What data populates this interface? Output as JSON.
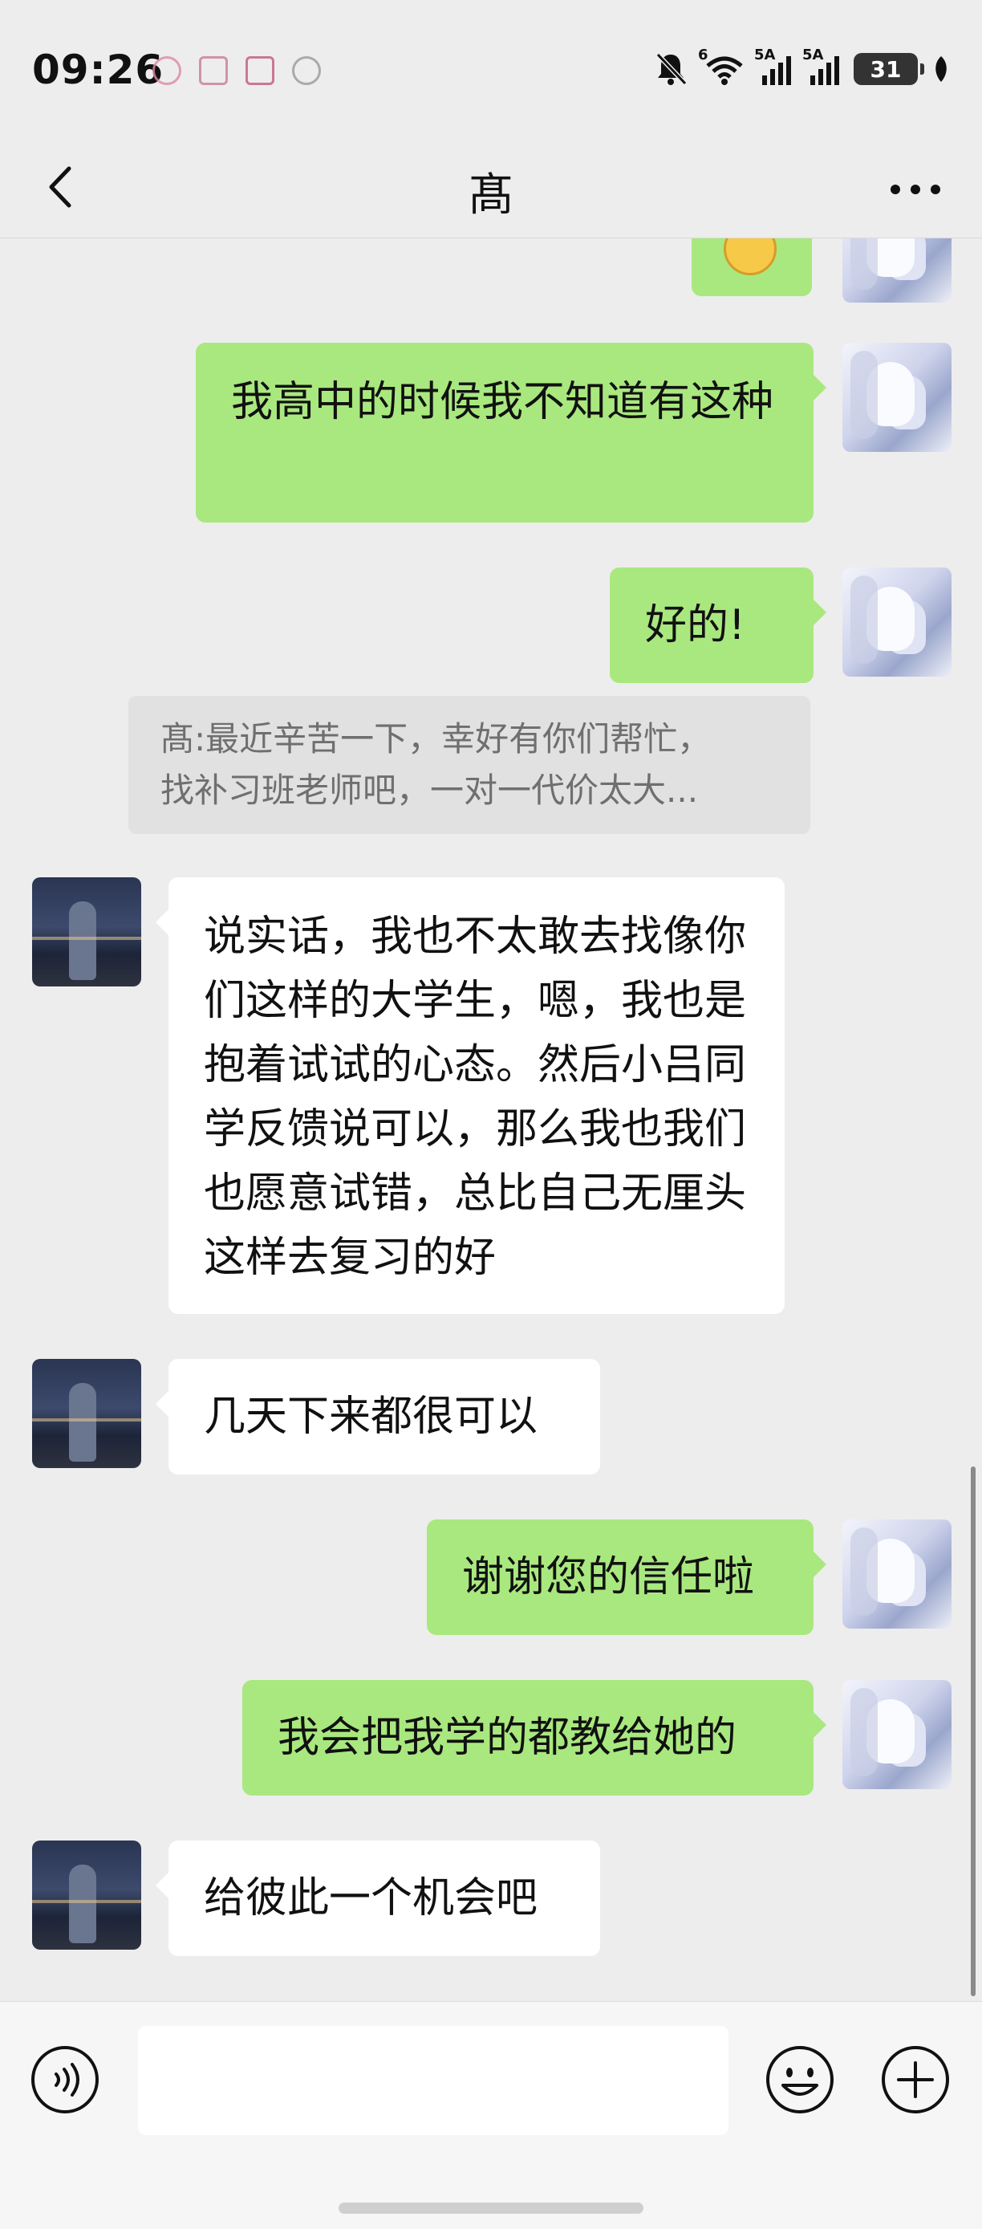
{
  "status_bar": {
    "time": "09:26",
    "signal_1_label": "5A",
    "signal_2_label": "5A",
    "wifi_label": "6",
    "battery": "31"
  },
  "header": {
    "title": "髙",
    "back_icon": "chevron-left-icon",
    "more_icon": "more-horizontal-icon"
  },
  "messages": [
    {
      "side": "mine",
      "text": "我高中的时候我不知道有这种"
    },
    {
      "side": "mine",
      "text": "好的!"
    },
    {
      "side": "theirs",
      "text": "说实话，我也不太敢去找像你们这样的大学生，嗯，我也是抱着试试的心态。然后小吕同学反馈说可以，那么我也我们也愿意试错，总比自己无厘头这样去复习的好"
    },
    {
      "side": "theirs",
      "text": "几天下来都很可以"
    },
    {
      "side": "mine",
      "text": "谢谢您的信任啦"
    },
    {
      "side": "mine",
      "text": "我会把我学的都教给她的"
    },
    {
      "side": "theirs",
      "text": "给彼此一个机会吧"
    }
  ],
  "quote": {
    "line1": "髙:最近辛苦一下，幸好有你们帮忙，",
    "line2": "找补习班老师吧，一对一代价太大..."
  },
  "input_bar": {
    "placeholder": "",
    "voice_icon": "voice-icon",
    "emoji_icon": "emoji-icon",
    "plus_icon": "plus-icon"
  },
  "colors": {
    "background": "#ededed",
    "mine_bubble": "#a9e87f",
    "theirs_bubble": "#ffffff"
  }
}
